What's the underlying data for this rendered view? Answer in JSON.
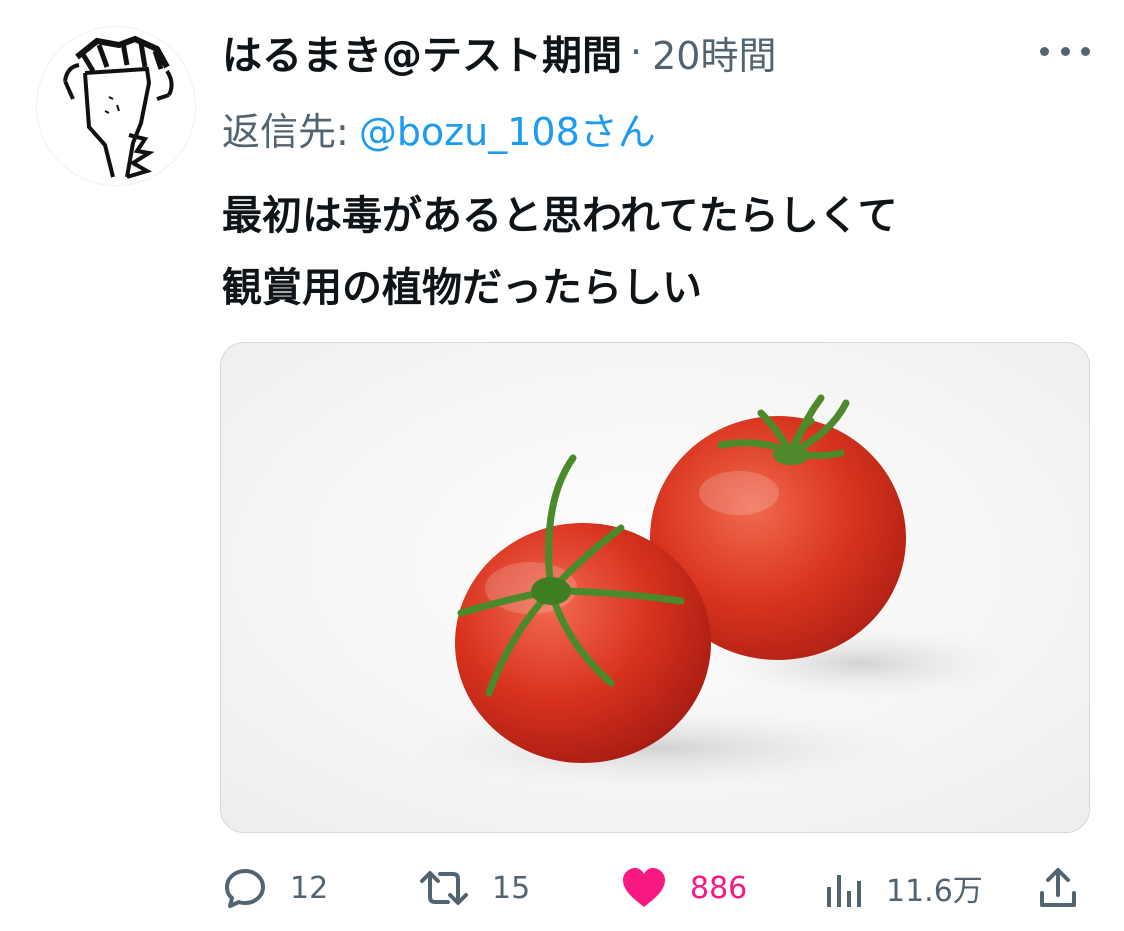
{
  "tweet": {
    "author_name": "はるまき@テスト期間",
    "separator": "·",
    "timestamp": "20時間",
    "reply_prefix": "返信先:",
    "reply_handle": "@bozu_108さん",
    "text_lines": [
      "最初は毒があると思われてたらしくて",
      "観賞用の植物だったらしい"
    ]
  },
  "icons": {
    "avatar": "avatar-drawing",
    "more": "more-dots-icon",
    "reply": "reply-bubble-icon",
    "retweet": "retweet-icon",
    "like": "heart-icon",
    "views": "views-bars-icon",
    "share": "share-icon"
  },
  "actions": {
    "replies": "12",
    "retweets": "15",
    "likes": "886",
    "views": "11.6万"
  },
  "colors": {
    "text": "#0f1419",
    "secondary": "#536471",
    "link": "#1d9bf0",
    "like": "#f91880"
  }
}
